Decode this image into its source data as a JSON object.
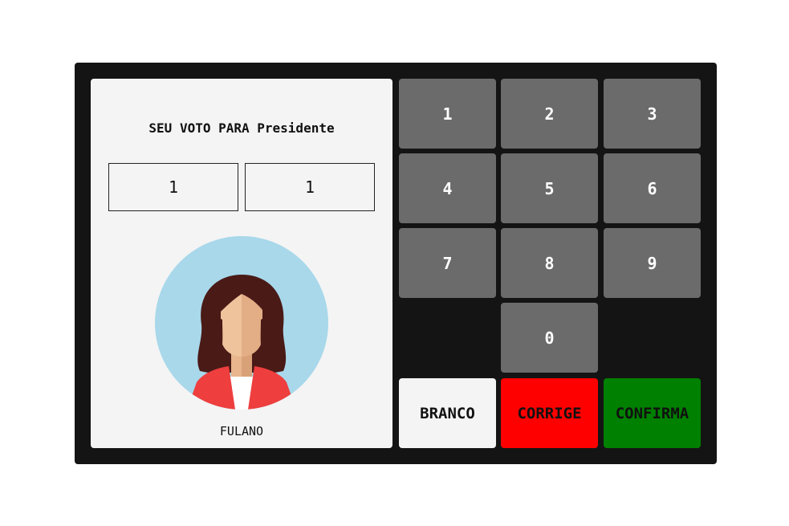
{
  "screen": {
    "title": "SEU VOTO PARA Presidente",
    "digits": [
      "1",
      "1"
    ],
    "candidate_name": "FULANO"
  },
  "keypad": {
    "keys": [
      "1",
      "2",
      "3",
      "4",
      "5",
      "6",
      "7",
      "8",
      "9",
      "0"
    ],
    "branco_label": "BRANCO",
    "corrige_label": "CORRIGE",
    "confirma_label": "CONFIRMA"
  },
  "colors": {
    "machine_bg": "#141414",
    "screen_bg": "#f4f4f4",
    "key_bg": "#6a6b6a",
    "branco": "#f4f4f4",
    "corrige": "#ff0000",
    "confirma": "#008000",
    "avatar_bg": "#a8d8ea"
  },
  "icons": {
    "candidate_photo": "woman-avatar-icon"
  }
}
